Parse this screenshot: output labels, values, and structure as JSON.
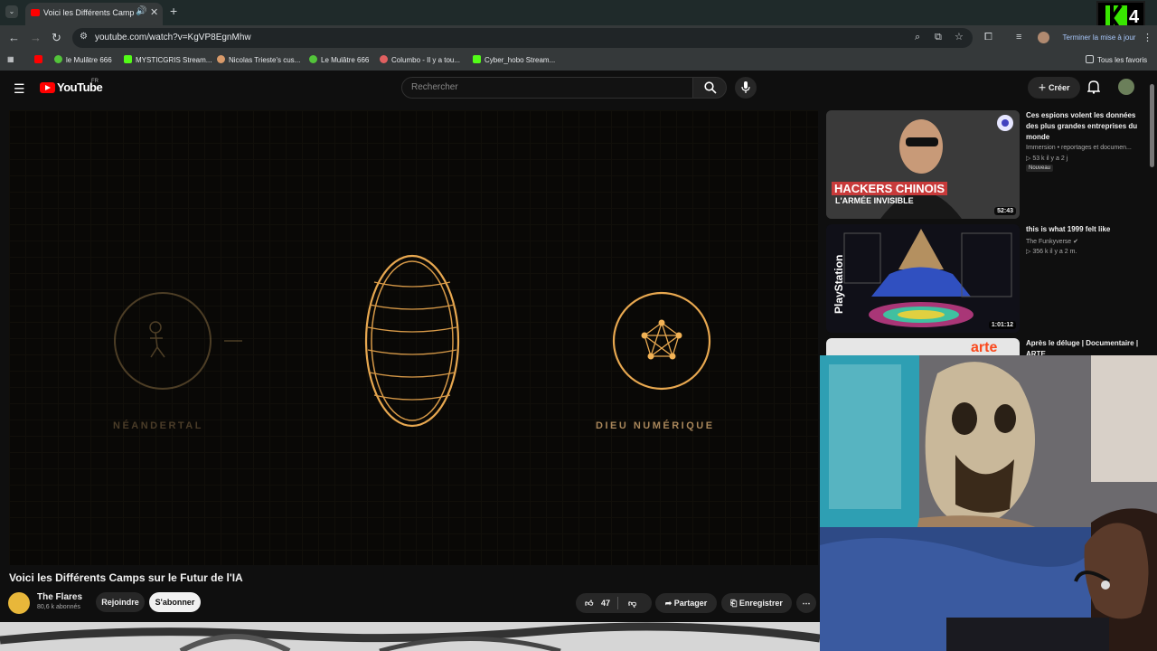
{
  "browser": {
    "tab_title": "Voici les Différents Camps sur le Futur de l'IA",
    "url": "youtube.com/watch?v=KgVP8EgnMhw",
    "update_label": "Terminer la mise à jour",
    "bookmarks": [
      "le Mulâtre 666",
      "MYSTICGRIS Stream...",
      "Nicolas Trieste's cus...",
      "Le Mulâtre 666",
      "Columbo - Il y a tou...",
      "Cyber_hobo Stream..."
    ],
    "all_bookmarks_label": "Tous les favoris"
  },
  "overlay_logo": {
    "number": "4"
  },
  "youtube": {
    "wordmark": "YouTube",
    "country": "FR",
    "search_placeholder": "Rechercher",
    "create_label": "Créer"
  },
  "player": {
    "left_label": "NÉANDERTAL",
    "right_label": "DIEU NUMÉRIQUE"
  },
  "video": {
    "title": "Voici les Différents Camps sur le Futur de l'IA",
    "channel": "The Flares",
    "subscribers": "80,6 k abonnés",
    "join_label": "Rejoindre",
    "subscribe_label": "S'abonner",
    "likes": "47",
    "share_label": "Partager",
    "save_label": "Enregistrer"
  },
  "sidebar": [
    {
      "title": "Ces espions volent les données des plus grandes entreprises du monde",
      "channel": "Immersion • reportages et documen...",
      "stats": "53 k  il y a 2 j",
      "badge": "Nouveau",
      "duration": "52:43",
      "thumb_text_1": "HACKERS CHINOIS",
      "thumb_text_2": "L'ARMÉE INVISIBLE"
    },
    {
      "title": "this is what 1999 felt like",
      "channel": "The Funkyverse",
      "stats": "356 k  il y a 2 m.",
      "duration": "1:01:12",
      "thumb_text_1": "PlayStation"
    },
    {
      "title": "Après le déluge | Documentaire | ARTE",
      "thumb_text_1": "arte"
    }
  ]
}
